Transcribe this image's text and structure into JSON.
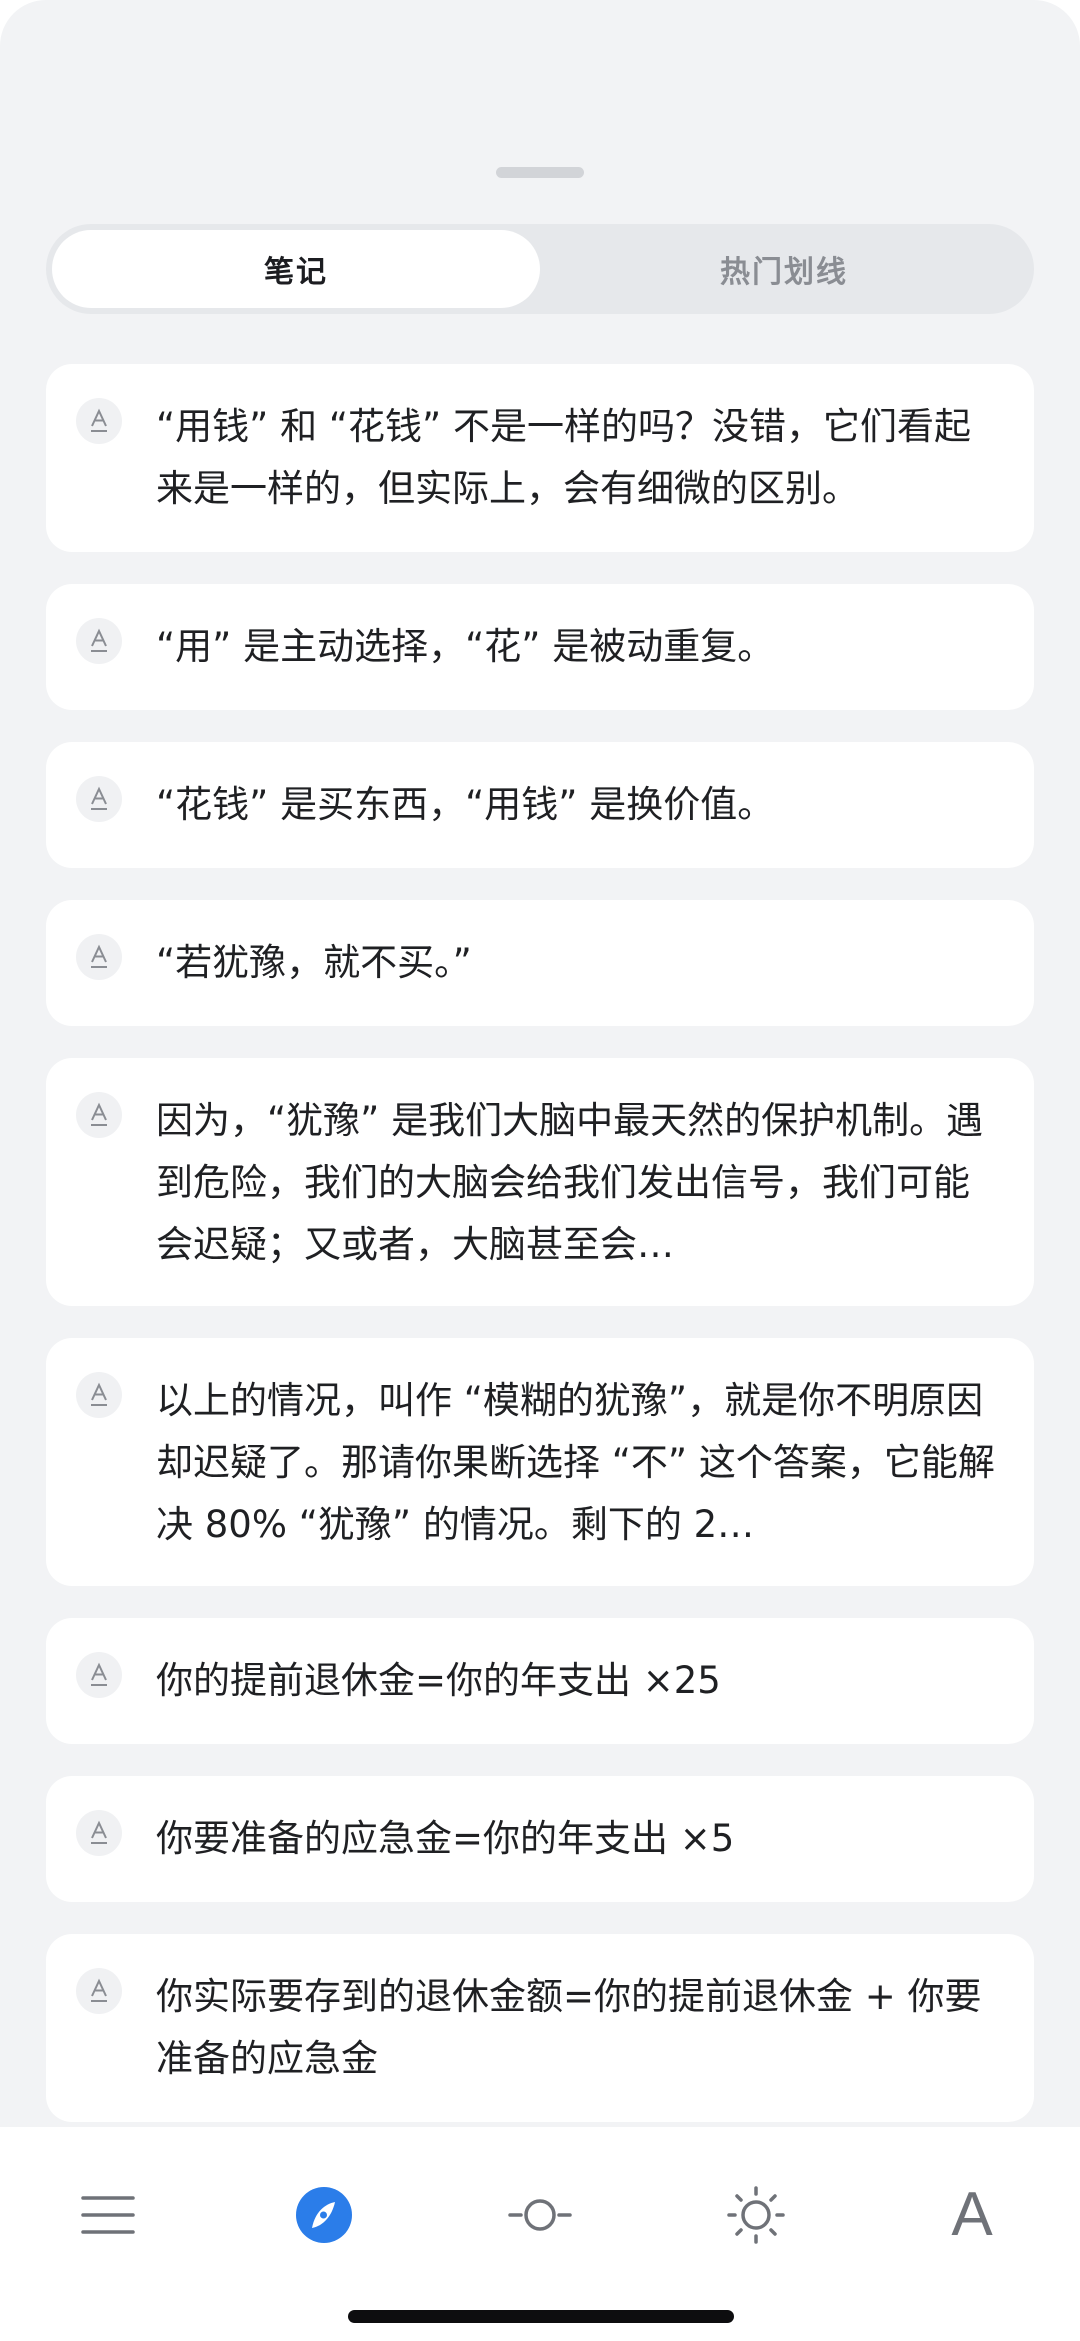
{
  "tabs": {
    "notes": "笔记",
    "popular": "热门划线"
  },
  "notes": [
    {
      "text": "“用钱” 和 “花钱” 不是一样的吗？没错，它们看起来是一样的，但实际上，会有细微的区别。"
    },
    {
      "text": "“用” 是主动选择，“花” 是被动重复。"
    },
    {
      "text": "“花钱” 是买东西，“用钱” 是换价值。"
    },
    {
      "text": "“若犹豫，就不买。”"
    },
    {
      "text": "因为，“犹豫” 是我们大脑中最天然的保护机制。遇到危险，我们的大脑会给我们发出信号，我们可能会迟疑；又或者，大脑甚至会…"
    },
    {
      "text": "以上的情况，叫作 “模糊的犹豫”，就是你不明原因却迟疑了。那请你果断选择 “不” 这个答案，它能解决 80% “犹豫” 的情况。剩下的 2…"
    },
    {
      "text": "你的提前退休金=你的年支出 ×25"
    },
    {
      "text": "你要准备的应急金=你的年支出 ×5"
    },
    {
      "text": "你实际要存到的退休金额=你的提前退休金 + 你要准备的应急金"
    }
  ],
  "toolbar": {
    "icons": [
      "menu-icon",
      "compass-icon",
      "brightness-slider-icon",
      "sun-icon",
      "font-icon"
    ],
    "font_label": "A"
  },
  "colors": {
    "background": "#f2f3f5",
    "card": "#ffffff",
    "accent": "#2b7de9",
    "text": "#1f2023",
    "icon": "#6f7278"
  }
}
